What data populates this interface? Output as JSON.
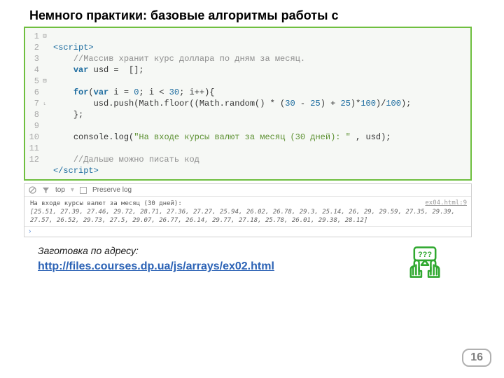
{
  "heading": "Немного практики: базовые алгоритмы работы с",
  "code": {
    "lines": [
      1,
      2,
      3,
      4,
      5,
      6,
      7,
      8,
      9,
      10,
      11,
      12
    ],
    "folds": {
      "1": "⊟",
      "5": "⊟",
      "7": "˪"
    },
    "l1_open": "<script>",
    "l2_comment": "//Массив хранит курс доллара по дням за месяц.",
    "l3_var": "var",
    "l3_rest": " usd =  [];",
    "l5_for": "for",
    "l5a": "(",
    "l5_var": "var",
    "l5b": " i = ",
    "l5_zero": "0",
    "l5c": "; i < ",
    "l5_thirty": "30",
    "l5d": "; i++){",
    "l6a": "usd.push(Math.floor((Math.random() * (",
    "l6_n30": "30",
    "l6b": " - ",
    "l6_n25": "25",
    "l6c": ") + ",
    "l6_n25b": "25",
    "l6d": ")*",
    "l6_n100": "100",
    "l6e": ")/",
    "l6_n100b": "100",
    "l6f": ");",
    "l7": "};",
    "l9a": "console.log(",
    "l9_str": "\"На входе курсы валют за месяц (30 дней): \"",
    "l9b": " , usd);",
    "l11_comment": "//Дальше можно писать код",
    "l12_close": "</script>"
  },
  "console": {
    "toolbar": {
      "clear_title": "clear",
      "filter_title": "filter",
      "top": "top",
      "preserve": "Preserve log"
    },
    "source": "ex04.html:9",
    "line1": "На входе курсы валют за месяц (30 дней):",
    "line2": "[25.51, 27.39, 27.46, 29.72, 28.71, 27.36, 27.27, 25.94, 26.02, 26.78, 29.3, 25.14, 26, 29, 29.59, 27.35, 29.39, 27.57, 26.52, 29.73, 27.5, 29.07, 26.77, 26.14, 29.77, 27.18, 25.78, 26.01, 29.38, 28.12]",
    "prompt": "›"
  },
  "caption": "Заготовка по адресу:",
  "link": "http://files.courses.dp.ua/js/arrays/ex02.html",
  "question_label": "???",
  "page_number": "16",
  "chart_data": {
    "type": "table",
    "title": "Курсы валют за месяц (30 дней)",
    "values": [
      25.51,
      27.39,
      27.46,
      29.72,
      28.71,
      27.36,
      27.27,
      25.94,
      26.02,
      26.78,
      29.3,
      25.14,
      26.0,
      29.0,
      29.59,
      27.35,
      29.39,
      27.57,
      26.52,
      29.73,
      27.5,
      29.07,
      26.77,
      26.14,
      29.77,
      27.18,
      25.78,
      26.01,
      29.38,
      28.12
    ],
    "count": 30,
    "min_generated": 25,
    "max_generated": 30,
    "precision": 2
  }
}
